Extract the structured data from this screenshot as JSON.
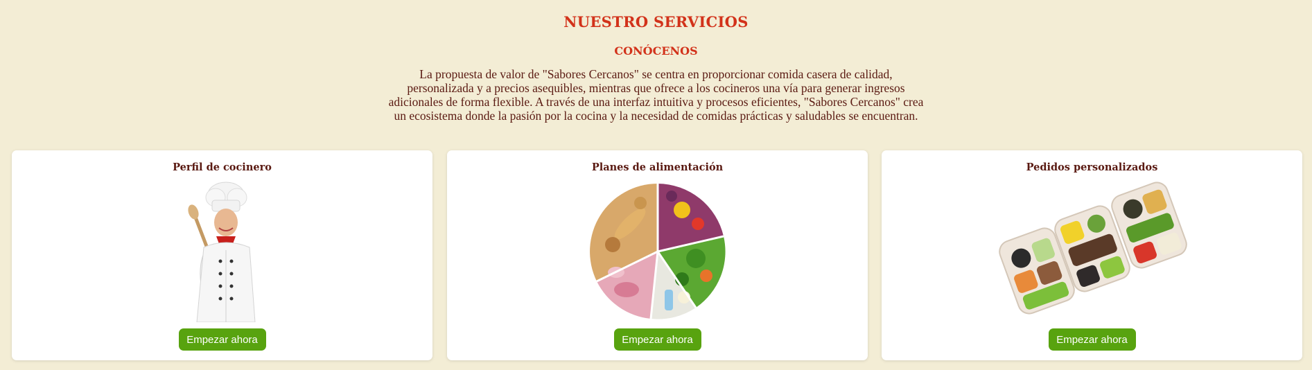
{
  "services": {
    "title": "NUESTRO SERVICIOS",
    "subtitle": "CONÓCENOS",
    "description": "La propuesta de valor de \"Sabores Cercanos\" se centra en proporcionar comida casera de calidad, personalizada y a precios asequibles, mientras que ofrece a los cocineros una vía para generar ingresos adicionales de forma flexible. A través de una interfaz intuitiva y procesos eficientes, \"Sabores Cercanos\" crea un ecosistema donde la pasión por la cocina y la necesidad de comidas prácticas y saludables se encuentran."
  },
  "cards": [
    {
      "title": "Perfil de cocinero",
      "image": "chef-image",
      "button_label": "Empezar ahora"
    },
    {
      "title": "Planes de alimentación",
      "image": "food-wheel-image",
      "button_label": "Empezar ahora"
    },
    {
      "title": "Pedidos personalizados",
      "image": "meal-containers-image",
      "button_label": "Empezar ahora"
    }
  ],
  "colors": {
    "background": "#f3edd5",
    "heading": "#d2321a",
    "text": "#5a1a12",
    "button": "#58a30f",
    "card": "#ffffff"
  }
}
